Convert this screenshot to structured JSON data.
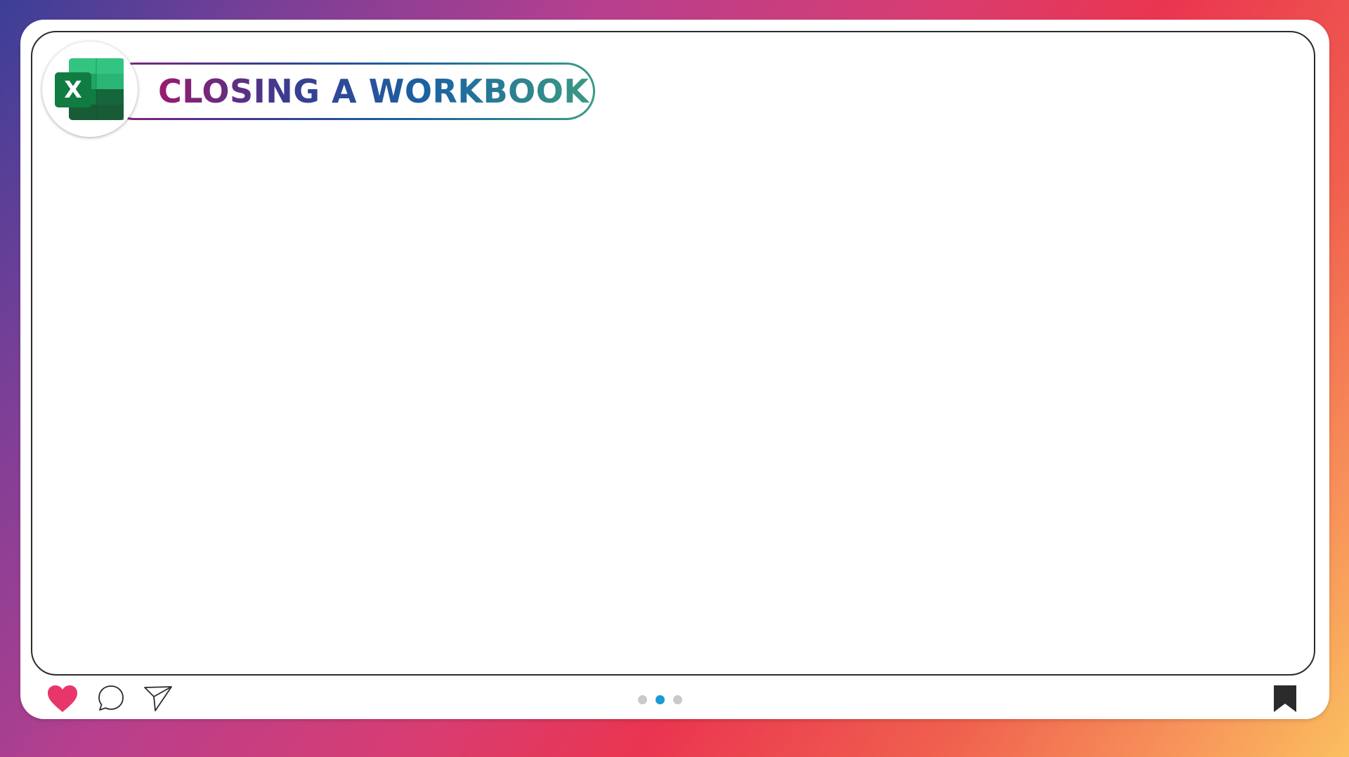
{
  "slide": {
    "title": "CLOSING A WORKBOOK",
    "app_icon": "excel-icon",
    "app_icon_letter": "X"
  },
  "footer": {
    "icons": [
      "heart-icon",
      "comment-icon",
      "send-icon",
      "bookmark-icon"
    ],
    "carousel": {
      "count": 3,
      "active_index": 1
    }
  },
  "colors": {
    "heart": "#e8366a",
    "dot_active": "#1a9bd7",
    "dot_inactive": "#c9c9c9",
    "excel_dark": "#185c37",
    "excel_mid": "#21a366",
    "excel_light": "#33c481",
    "excel_badge": "#107c41"
  }
}
